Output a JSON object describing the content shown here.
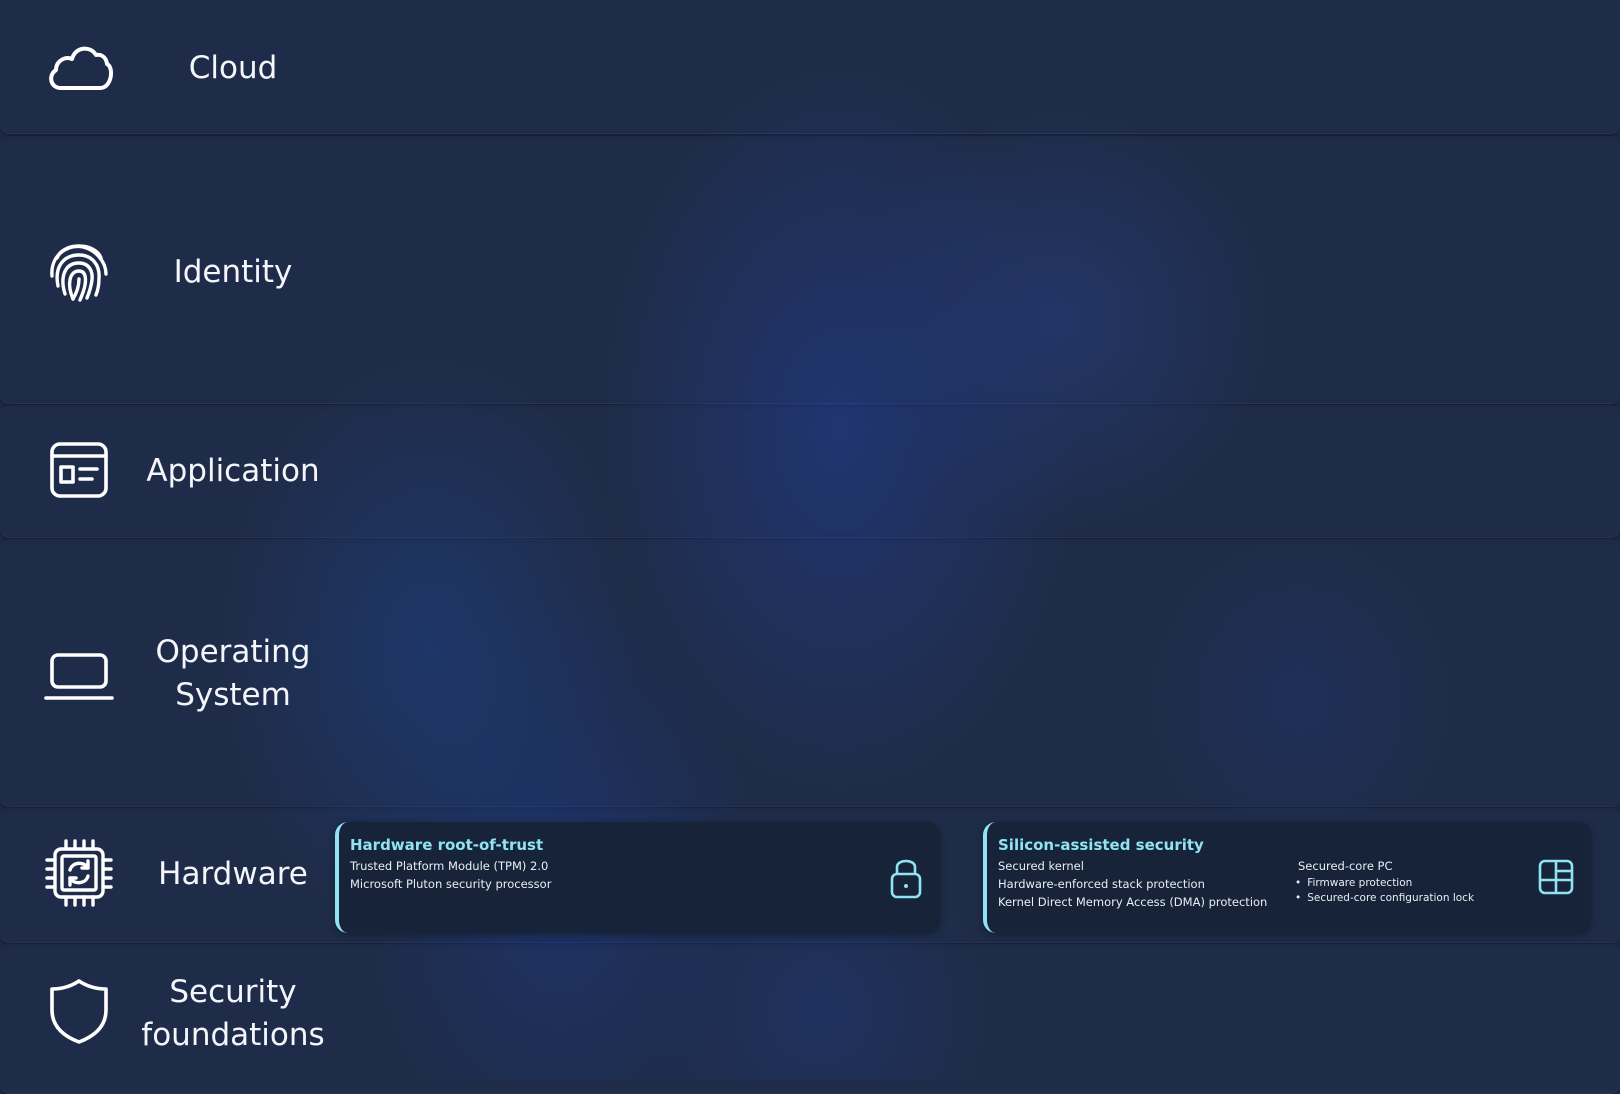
{
  "layers": [
    {
      "id": "cloud",
      "label": "Cloud",
      "icon": "cloud-icon"
    },
    {
      "id": "identity",
      "label": "Identity",
      "icon": "fingerprint-icon"
    },
    {
      "id": "application",
      "label": "Application",
      "icon": "app-window-icon"
    },
    {
      "id": "operating-system",
      "label": "Operating\nSystem",
      "icon": "laptop-icon"
    },
    {
      "id": "hardware",
      "label": "Hardware",
      "icon": "chip-icon"
    },
    {
      "id": "security-foundations",
      "label": "Security\nfoundations",
      "icon": "shield-icon"
    }
  ],
  "hardware_cards": [
    {
      "title": "Hardware root-of-trust",
      "lines": [
        "Trusted Platform Module (TPM) 2.0",
        "Microsoft Pluton security processor"
      ],
      "icon": "lock-icon"
    },
    {
      "title": "Silicon-assisted security",
      "lines": [
        "Secured kernel",
        "Hardware-enforced stack protection",
        "Kernel Direct Memory Access (DMA) protection"
      ],
      "side_heading": "Secured-core PC",
      "side_bullets": [
        "Firmware protection",
        "Secured-core configuration lock"
      ],
      "icon": "layout-panels-icon"
    }
  ],
  "colors": {
    "accent": "#8fe3f3",
    "row_bg": "#1f2c49",
    "card_bg": "#172338"
  }
}
